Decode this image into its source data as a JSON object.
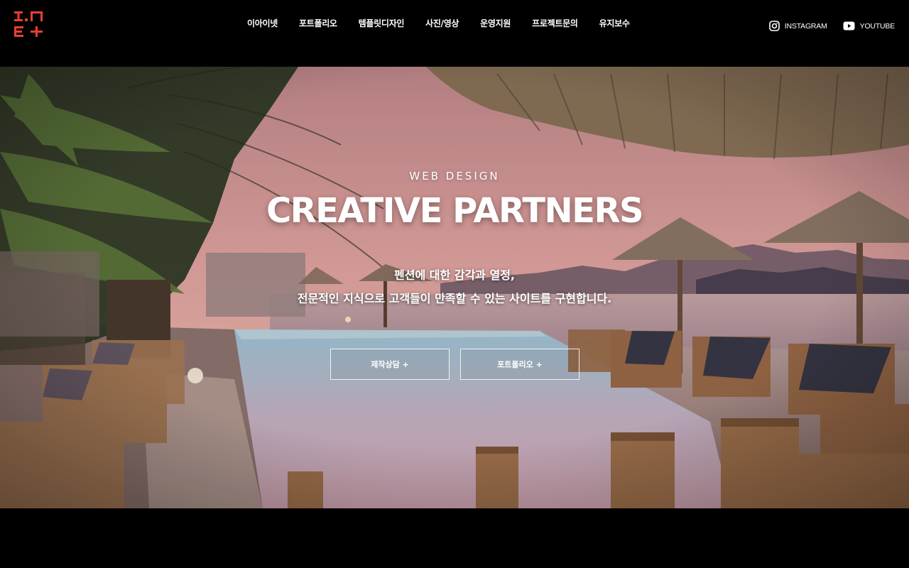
{
  "brand": {
    "logo_icon": "inet-logo",
    "accent": "#e8402f"
  },
  "nav": {
    "items": [
      {
        "label": "이아이넷"
      },
      {
        "label": "포트폴리오"
      },
      {
        "label": "템플릿디자인"
      },
      {
        "label": "사진/영상"
      },
      {
        "label": "운영지원"
      },
      {
        "label": "프로젝트문의"
      },
      {
        "label": "유지보수"
      }
    ]
  },
  "social": {
    "instagram": {
      "label": "INSTAGRAM",
      "icon": "instagram-icon"
    },
    "youtube": {
      "label": "YOUTUBE",
      "icon": "youtube-icon"
    }
  },
  "hero": {
    "kicker": "WEB DESIGN",
    "title": "CREATIVE PARTNERS",
    "subtitle_line1": "펜션에 대한 감각과 열정,",
    "subtitle_line2": "전문적인 지식으로 고객들이 만족할 수 있는 사이트를 구현합니다.",
    "buttons": [
      {
        "label": "제작상담 +"
      },
      {
        "label": "포트폴리오 +"
      }
    ]
  }
}
